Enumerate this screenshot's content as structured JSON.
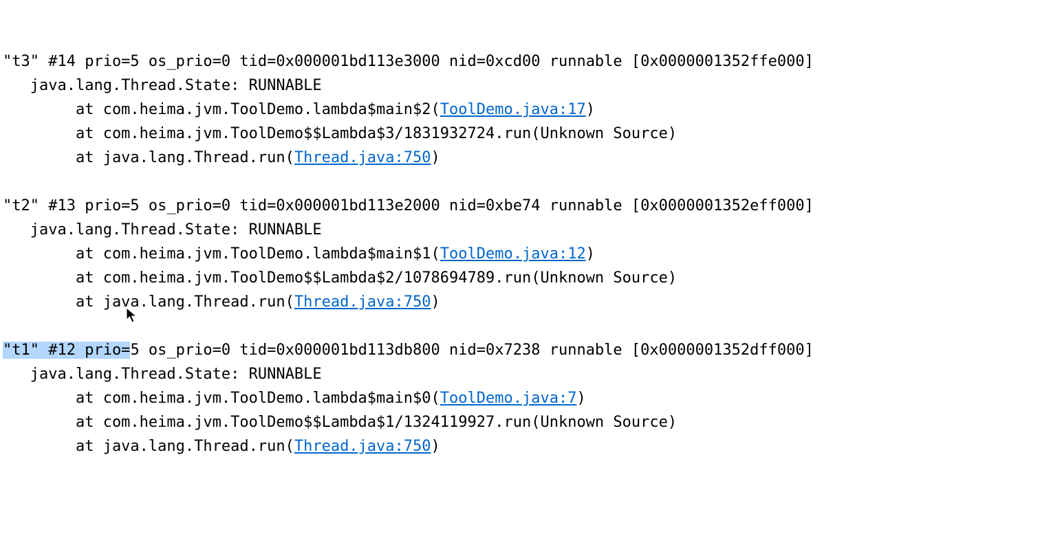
{
  "threads": [
    {
      "header": "\"t3\" #14 prio=5 os_prio=0 tid=0x000001bd113e3000 nid=0xcd00 runnable [0x0000001352ffe000]",
      "state_line": "   java.lang.Thread.State: RUNNABLE",
      "frames": [
        {
          "prefix": "        at com.heima.jvm.ToolDemo.lambda$main$2(",
          "link": "ToolDemo.java:17",
          "suffix": ")"
        },
        {
          "prefix": "        at com.heima.jvm.ToolDemo$$Lambda$3/1831932724.run(Unknown Source)",
          "link": "",
          "suffix": ""
        },
        {
          "prefix": "        at java.lang.Thread.run(",
          "link": "Thread.java:750",
          "suffix": ")"
        }
      ]
    },
    {
      "header": "\"t2\" #13 prio=5 os_prio=0 tid=0x000001bd113e2000 nid=0xbe74 runnable [0x0000001352eff000]",
      "state_line": "   java.lang.Thread.State: RUNNABLE",
      "frames": [
        {
          "prefix": "        at com.heima.jvm.ToolDemo.lambda$main$1(",
          "link": "ToolDemo.java:12",
          "suffix": ")"
        },
        {
          "prefix": "        at com.heima.jvm.ToolDemo$$Lambda$2/1078694789.run(Unknown Source)",
          "link": "",
          "suffix": ""
        },
        {
          "prefix": "        at java.lang.Thread.run(",
          "link": "Thread.java:750",
          "suffix": ")"
        }
      ]
    },
    {
      "header_selected_prefix": "\"t1\" #12 prio=",
      "header_rest": "5 os_prio=0 tid=0x000001bd113db800 nid=0x7238 runnable [0x0000001352dff000]",
      "state_line": "   java.lang.Thread.State: RUNNABLE",
      "frames": [
        {
          "prefix": "        at com.heima.jvm.ToolDemo.lambda$main$0(",
          "link": "ToolDemo.java:7",
          "suffix": ")"
        },
        {
          "prefix": "        at com.heima.jvm.ToolDemo$$Lambda$1/1324119927.run(Unknown Source)",
          "link": "",
          "suffix": ""
        },
        {
          "prefix": "        at java.lang.Thread.run(",
          "link": "Thread.java:750",
          "suffix": ")"
        }
      ]
    }
  ]
}
